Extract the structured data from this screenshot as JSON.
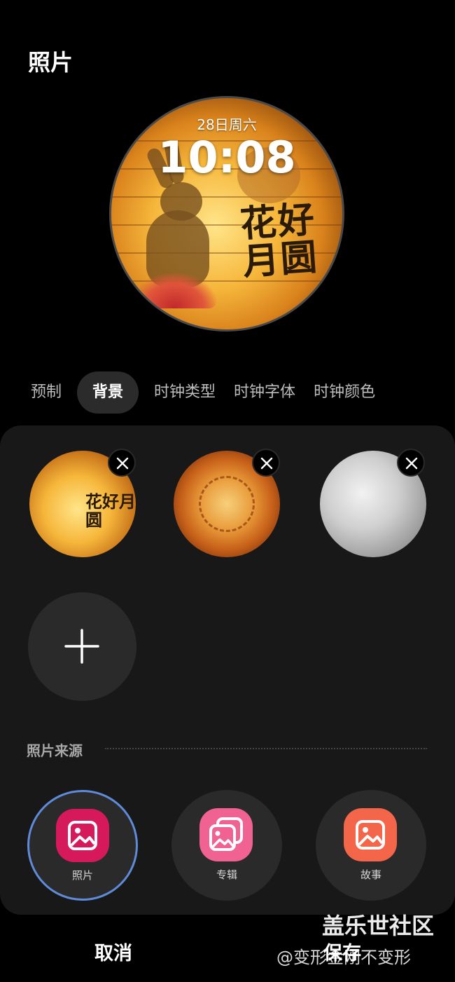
{
  "header": {
    "title": "照片"
  },
  "watch": {
    "date": "28日周六",
    "time": "10:08",
    "calligraphy": "花好月圆"
  },
  "tabs": [
    {
      "label": "预制",
      "active": false
    },
    {
      "label": "背景",
      "active": true
    },
    {
      "label": "时钟类型",
      "active": false
    },
    {
      "label": "时钟字体",
      "active": false
    },
    {
      "label": "时钟颜色",
      "active": false
    }
  ],
  "backgrounds": {
    "items": [
      {
        "name": "lantern",
        "calligraphy": "花好月圆"
      },
      {
        "name": "mooncake"
      },
      {
        "name": "moon"
      }
    ],
    "remove_icon": "close-icon",
    "add_icon": "plus-icon"
  },
  "photo_source": {
    "label": "照片来源",
    "items": [
      {
        "label": "照片",
        "icon": "gallery-icon",
        "color": "#d6195b",
        "selected": true
      },
      {
        "label": "专辑",
        "icon": "albums-icon",
        "color": "#f06292",
        "selected": false
      },
      {
        "label": "故事",
        "icon": "stories-icon",
        "color": "#f4664a",
        "selected": false
      }
    ]
  },
  "footer": {
    "cancel": "取消",
    "save": "保存"
  },
  "watermark": {
    "line1": "盖乐世社区",
    "line2": "@变形金刚不变形"
  },
  "colors": {
    "background": "#000000",
    "panel": "#181818",
    "selection_ring": "#5f8bd8"
  }
}
